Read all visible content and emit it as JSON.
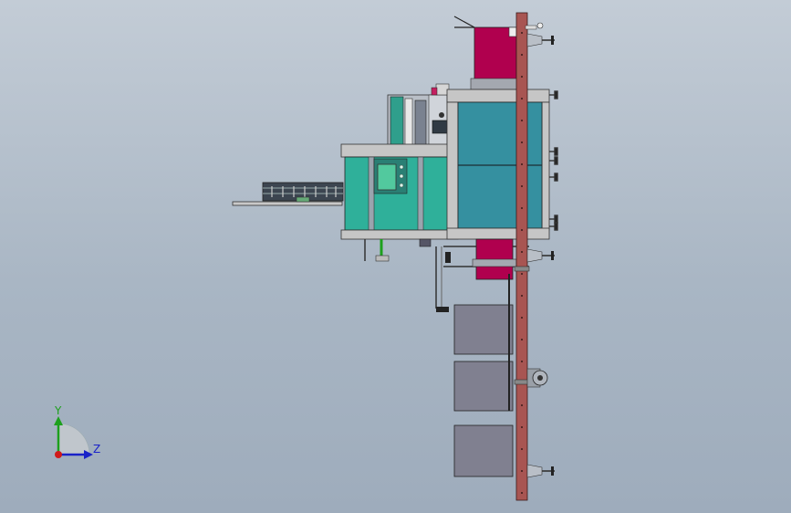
{
  "triad": {
    "y_label": "Y",
    "z_label": "Z",
    "colors": {
      "y": "#1da01d",
      "z": "#1a22c8",
      "x": "#d01a1a"
    }
  },
  "colors": {
    "background_top": "#c3ccd6",
    "background_bottom": "#9eacbc",
    "housing_teal": "#2fb09a",
    "tank_blue": "#3590a0",
    "bin_magenta": "#b0004e",
    "post_rust": "#a85552",
    "frame_grey": "#c6c6c6",
    "hopper_grey": "#808090",
    "panel_green": "#52c99e"
  }
}
